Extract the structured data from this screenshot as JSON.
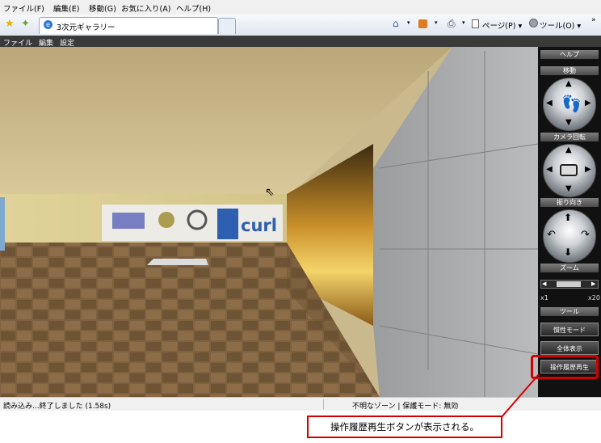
{
  "ie_menu": [
    "ファイル(F)",
    "編集(E)",
    "移動(G)",
    "お気に入り(A)",
    "ヘルプ(H)"
  ],
  "tab_title": "3次元ギャラリー",
  "toolbar": {
    "page": "ページ(P) ▾",
    "tools": "ツール(O) ▾",
    "chevron": "»"
  },
  "app_menu": [
    "ファイル",
    "編集",
    "設定"
  ],
  "scene": {
    "logo_text": "curl"
  },
  "panel": {
    "help": "ヘルプ",
    "move": "移動",
    "camera": "カメラ回転",
    "direction": "振り向き",
    "zoom": "ズーム",
    "zoom_min": "x1",
    "zoom_max": "x20",
    "tools": "ツール",
    "inertia_button": "慣性モード",
    "show_all_button": "全体表示",
    "replay_button": "操作履歴再生"
  },
  "status": {
    "loaded": "読み込み...終了しました (1.58s)",
    "zone": "不明なゾーン | 保護モード: 無効"
  },
  "annotation": {
    "callout": "操作履歴再生ボタンが表示される。"
  },
  "colors": {
    "highlight": "#d40000",
    "panel": "#111111",
    "floor": "#7a5e3a",
    "ceiling": "#c9b98c"
  },
  "zoom_level": 0.5
}
